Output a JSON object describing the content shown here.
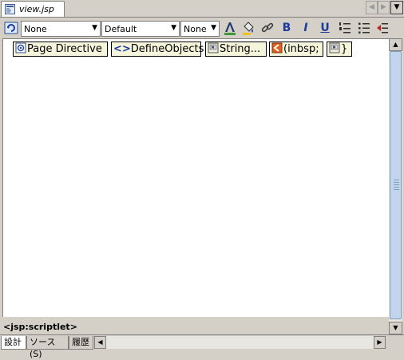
{
  "tab": {
    "title": "view.jsp",
    "icon": "jsp-file-icon"
  },
  "tab_nav": {
    "prev": "◀",
    "next": "▶",
    "menu": "▼"
  },
  "toolbar": {
    "paragraph_combo": "None",
    "font_combo": "Default",
    "size_combo": "None",
    "combo_arrow": "▼",
    "bold": "B",
    "italic": "I",
    "underline": "U"
  },
  "jsp_tags": [
    {
      "label": "Page Directive",
      "icon": "page-directive-icon"
    },
    {
      "label": "DefineObjects",
      "icon": "code-brackets-icon",
      "glyph": "<>"
    },
    {
      "label": "String...",
      "icon": "scriptlet-icon"
    },
    {
      "label": "(inbsp;",
      "icon": "entity-icon"
    },
    {
      "label": "}",
      "icon": "scriptlet-icon"
    }
  ],
  "status": {
    "element_path": "<jsp:scriptlet>"
  },
  "bottom_tabs": [
    {
      "label": "設計",
      "active": true
    },
    {
      "label": "ソース(S)",
      "active": false
    },
    {
      "label": "履歴",
      "active": false
    }
  ],
  "scroll": {
    "up": "▲",
    "down": "▼",
    "left": "◀",
    "right": "▶"
  }
}
